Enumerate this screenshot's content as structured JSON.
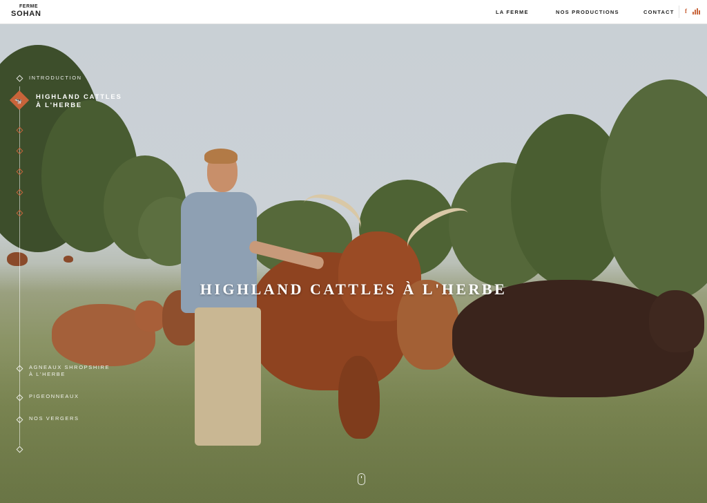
{
  "header": {
    "logo": {
      "line1": "FERME",
      "line2": "SOHAN"
    },
    "nav": [
      {
        "label": "LA FERME"
      },
      {
        "label": "NOS PRODUCTIONS"
      },
      {
        "label": "CONTACT"
      }
    ],
    "social": {
      "facebook_glyph": "f",
      "facebook_icon": "facebook-icon",
      "stats_icon": "bar-chart-icon",
      "accent": "#c8643a"
    }
  },
  "sidenav": {
    "items": [
      {
        "label": "INTRODUCTION"
      },
      {
        "label_line1": "HIGHLAND CATTLES",
        "label_line2": "À L'HERBE",
        "active": true
      },
      {
        "label_line1": "AGNEAUX SHROPSHIRE",
        "label_line2": "À L'HERBE"
      },
      {
        "label": "PIGEONNEAUX"
      },
      {
        "label": "NOS VERGERS"
      }
    ]
  },
  "hero": {
    "title": "HIGHLAND CATTLES À L'HERBE",
    "scroll_icon": "mouse-scroll-icon"
  }
}
